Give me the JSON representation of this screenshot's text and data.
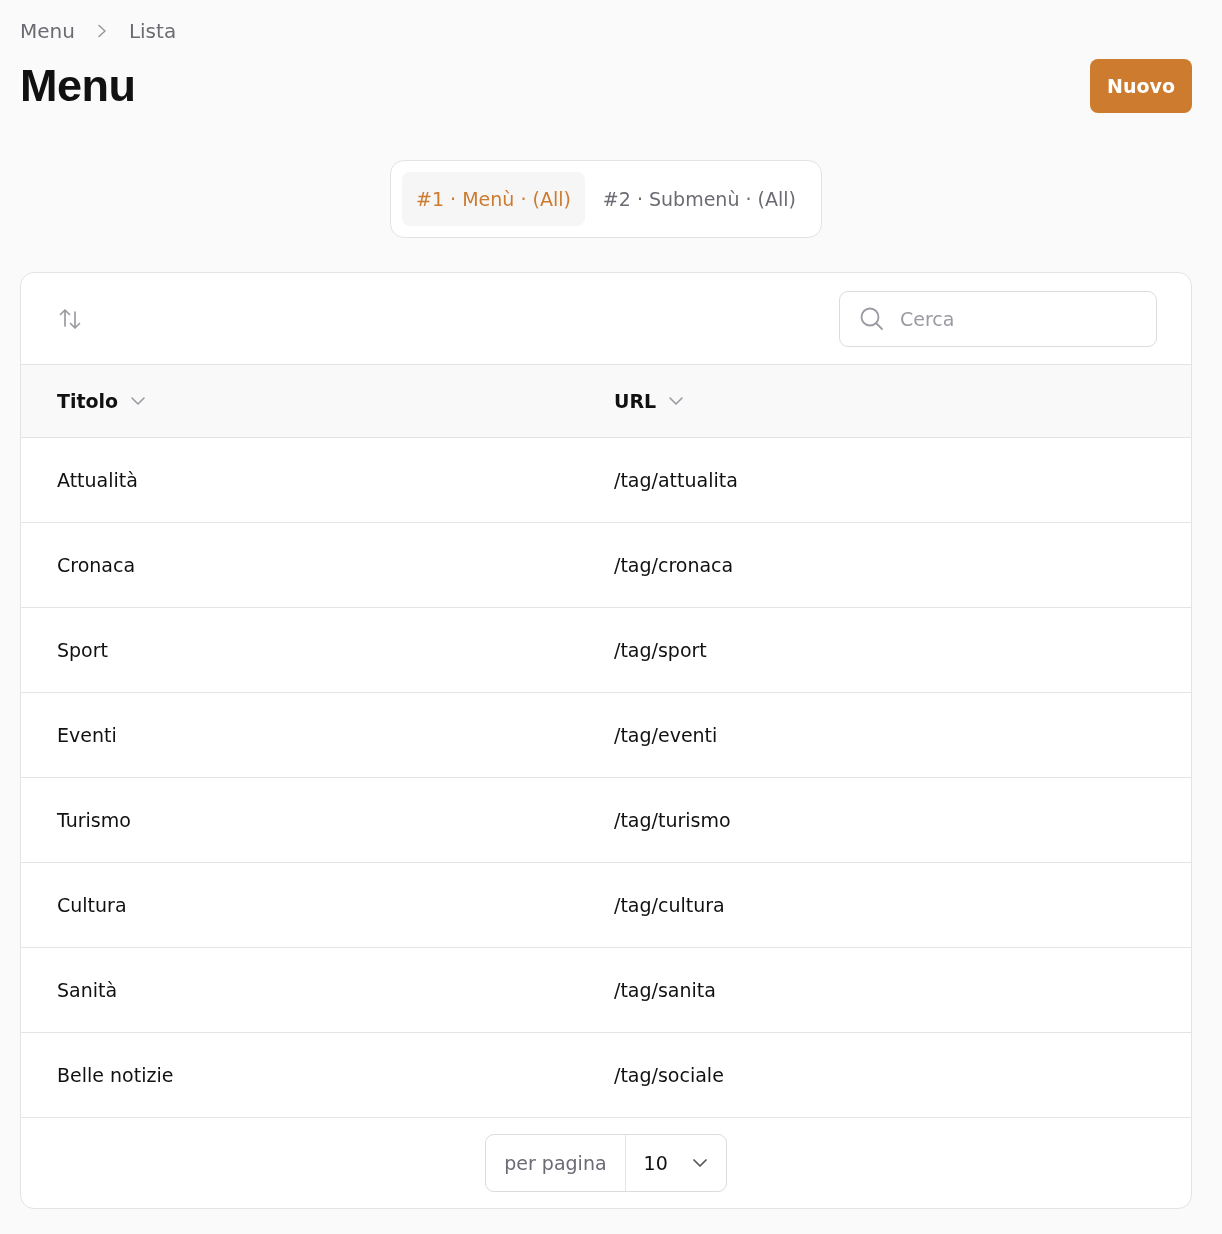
{
  "breadcrumb": [
    "Menu",
    "Lista"
  ],
  "title": "Menu",
  "new_button": "Nuovo",
  "tabs": [
    {
      "label": "#1 · Menù · (All)",
      "selected": true
    },
    {
      "label": "#2 · Submenù · (All)",
      "selected": false
    }
  ],
  "search": {
    "placeholder": "Cerca"
  },
  "table": {
    "columns": [
      "Titolo",
      "URL"
    ],
    "rows": [
      [
        "Attualità",
        "/tag/attualita"
      ],
      [
        "Cronaca",
        "/tag/cronaca"
      ],
      [
        "Sport",
        "/tag/sport"
      ],
      [
        "Eventi",
        "/tag/eventi"
      ],
      [
        "Turismo",
        "/tag/turismo"
      ],
      [
        "Cultura",
        "/tag/cultura"
      ],
      [
        "Sanità",
        "/tag/sanita"
      ],
      [
        "Belle notizie",
        "/tag/sociale"
      ]
    ]
  },
  "pagination": {
    "label": "per pagina",
    "value": "10"
  }
}
